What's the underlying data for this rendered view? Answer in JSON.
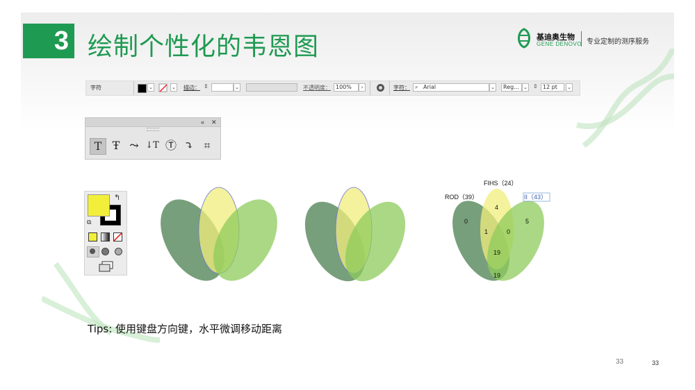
{
  "slide": {
    "number": "3",
    "title": "绘制个性化的韦恩图",
    "tips": "Tips: 使用键盘方向键，水平微调移动距离",
    "page_number_left": "33",
    "page_number_right": "33"
  },
  "logo": {
    "name_zh": "基迪奥生物",
    "name_en": "GENE DENOVO",
    "tagline": "专业定制的测序服务"
  },
  "toolbar": {
    "char_label": "字符",
    "stroke_label": "描边：",
    "opacity_label": "不透明度：",
    "opacity_value": "100%",
    "font_label": "字符：",
    "font_value": "Arial",
    "style_value": "Reg...",
    "size_value": "12 pt",
    "dropdown_glyph": "⌄",
    "arrow_glyph": "›"
  },
  "type_tools": [
    {
      "name": "type-tool",
      "glyph": "T"
    },
    {
      "name": "area-type-tool",
      "glyph": "Ŧ"
    },
    {
      "name": "type-on-path-tool",
      "glyph": "⤳"
    },
    {
      "name": "vertical-type-tool",
      "glyph": "↓T"
    },
    {
      "name": "vertical-area-type-tool",
      "glyph": "Ⓣ"
    },
    {
      "name": "vertical-type-on-path-tool",
      "glyph": "⤵"
    },
    {
      "name": "touch-type-tool",
      "glyph": "⌗"
    }
  ],
  "colors": {
    "brand_green": "#1f9a52",
    "fill_yellow": "#f2ef3a",
    "dark_green": "#4b7f4f",
    "yellow_ellipse": "#f0ee7c",
    "light_green": "#8ecb5b"
  },
  "venn": {
    "labels": {
      "top": "FIHS（24）",
      "left": "ROD（39）",
      "right": "II（43）"
    },
    "values": {
      "left_only": "0",
      "top_only": "4",
      "right_only": "5",
      "left_top": "1",
      "top_right": "0",
      "center": "19",
      "bottom": "19"
    }
  }
}
